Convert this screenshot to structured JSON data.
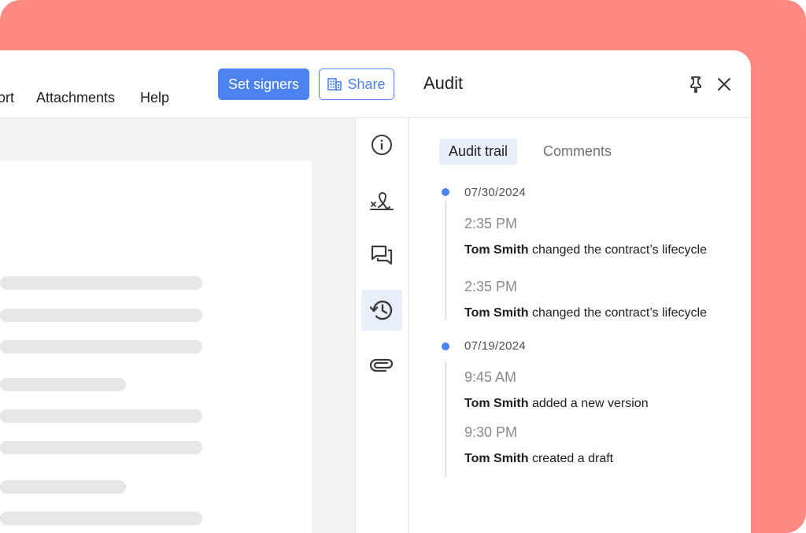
{
  "toolbar": {
    "menu_items": [
      "ort",
      "Attachments",
      "Help"
    ],
    "set_signers_label": "Set signers",
    "share_label": "Share"
  },
  "panel": {
    "title": "Audit",
    "pin_icon": "pin-icon",
    "close_icon": "close-icon"
  },
  "rail": {
    "icons": [
      "info-icon",
      "signature-icon",
      "comments-icon",
      "history-icon",
      "attachment-icon"
    ],
    "active": "history-icon"
  },
  "tabs": [
    {
      "label": "Audit trail",
      "active": true
    },
    {
      "label": "Comments",
      "active": false
    }
  ],
  "audit": {
    "groups": [
      {
        "date": "07/30/2024",
        "entries": [
          {
            "time": "2:35 PM",
            "user": "Tom Smith",
            "action": "changed the contract’s lifecycle"
          },
          {
            "time": "2:35 PM",
            "user": "Tom Smith",
            "action": "changed the contract’s lifecycle"
          }
        ]
      },
      {
        "date": "07/19/2024",
        "entries": [
          {
            "time": "9:45 AM",
            "user": "Tom Smith",
            "action": "added a new version"
          },
          {
            "time": "9:30 PM",
            "user": "Tom Smith",
            "action": "created a draft"
          }
        ]
      }
    ]
  },
  "colors": {
    "background": "#ff8882",
    "accent": "#4d82f3",
    "active_tab": "#e8eefb"
  }
}
